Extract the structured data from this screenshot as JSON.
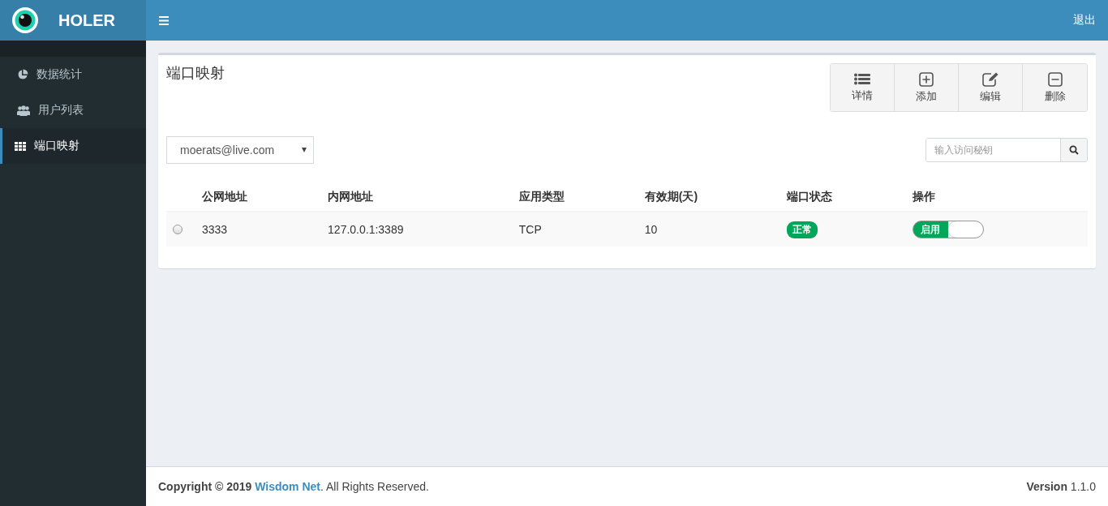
{
  "logo": {
    "title": "HOLER"
  },
  "header": {
    "logout": "退出"
  },
  "sidebar": {
    "items": [
      {
        "label": "数据统计",
        "kind": "pie",
        "selected": false
      },
      {
        "label": "用户列表",
        "kind": "users",
        "selected": false
      },
      {
        "label": "端口映射",
        "kind": "grid",
        "selected": true
      }
    ]
  },
  "panel": {
    "title": "端口映射",
    "toolbar": [
      {
        "label": "详情",
        "kind": "list"
      },
      {
        "label": "添加",
        "kind": "plus"
      },
      {
        "label": "编辑",
        "kind": "edit"
      },
      {
        "label": "删除",
        "kind": "minus"
      }
    ],
    "user_select": {
      "value": "moerats@live.com"
    },
    "search": {
      "placeholder": "输入访问秘钥"
    },
    "table": {
      "columns": [
        "公网地址",
        "内网地址",
        "应用类型",
        "有效期(天)",
        "端口状态",
        "操作"
      ],
      "rows": [
        {
          "selected": false,
          "public": "3333",
          "internal": "127.0.0.1:3389",
          "type": "TCP",
          "days": "10",
          "status": "正常",
          "toggle": {
            "label": "启用",
            "on": true
          }
        }
      ]
    }
  },
  "footer": {
    "copyright": "Copyright © 2019",
    "link": "Wisdom Net",
    "rest": ". All Rights Reserved.",
    "version": "**Version** 1.1.0"
  }
}
